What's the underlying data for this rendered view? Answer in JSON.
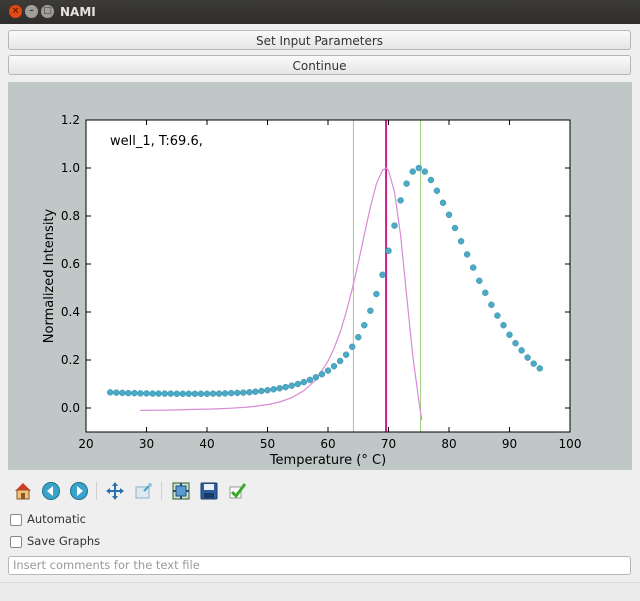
{
  "window": {
    "title": "NAMI"
  },
  "buttons": {
    "set_params_label": "Set Input Parameters",
    "continue_label": "Continue"
  },
  "plot": {
    "annotation": "well_1, T:69.6,"
  },
  "toolbar": {
    "icons": [
      "home-icon",
      "back-icon",
      "forward-icon",
      "pan-icon",
      "zoom-icon",
      "configure-subplots-icon",
      "save-icon",
      "check-icon"
    ]
  },
  "options": {
    "automatic_label": "Automatic",
    "automatic_checked": false,
    "save_graphs_label": "Save Graphs",
    "save_graphs_checked": false
  },
  "comment": {
    "placeholder": "Insert comments for the text file",
    "value": ""
  },
  "chart_data": {
    "type": "scatter",
    "title": "",
    "xlabel": "Temperature (° C)",
    "ylabel": "Normalized Intensity",
    "xlim": [
      20,
      100
    ],
    "ylim": [
      -0.1,
      1.2
    ],
    "xticks": [
      20,
      30,
      40,
      50,
      60,
      70,
      80,
      90,
      100
    ],
    "yticks": [
      0.0,
      0.2,
      0.4,
      0.6,
      0.8,
      1.0,
      1.2
    ],
    "xticklabels": [
      "20",
      "30",
      "40",
      "50",
      "60",
      "70",
      "80",
      "90",
      "100"
    ],
    "yticklabels": [
      "0.0",
      "0.2",
      "0.4",
      "0.6",
      "0.8",
      "1.0",
      "1.2"
    ],
    "series": [
      {
        "kind": "points",
        "color": "#4aabc7",
        "x": [
          24,
          25,
          26,
          27,
          28,
          29,
          30,
          31,
          32,
          33,
          34,
          35,
          36,
          37,
          38,
          39,
          40,
          41,
          42,
          43,
          44,
          45,
          46,
          47,
          48,
          49,
          50,
          51,
          52,
          53,
          54,
          55,
          56,
          57,
          58,
          59,
          60,
          61,
          62,
          63,
          64,
          65,
          66,
          67,
          68,
          69,
          70,
          71,
          72,
          73,
          74,
          75,
          76,
          77,
          78,
          79,
          80,
          81,
          82,
          83,
          84,
          85,
          86,
          87,
          88,
          89,
          90,
          91,
          92,
          93,
          94,
          95
        ],
        "y": [
          0.065,
          0.064,
          0.063,
          0.062,
          0.062,
          0.061,
          0.061,
          0.06,
          0.06,
          0.06,
          0.06,
          0.059,
          0.059,
          0.059,
          0.059,
          0.059,
          0.059,
          0.06,
          0.06,
          0.061,
          0.062,
          0.063,
          0.064,
          0.066,
          0.068,
          0.071,
          0.074,
          0.078,
          0.082,
          0.087,
          0.093,
          0.1,
          0.108,
          0.117,
          0.128,
          0.141,
          0.156,
          0.174,
          0.196,
          0.222,
          0.255,
          0.295,
          0.345,
          0.405,
          0.475,
          0.555,
          0.655,
          0.76,
          0.865,
          0.935,
          0.985,
          1.0,
          0.985,
          0.95,
          0.905,
          0.855,
          0.805,
          0.75,
          0.695,
          0.64,
          0.585,
          0.53,
          0.48,
          0.43,
          0.385,
          0.345,
          0.305,
          0.27,
          0.24,
          0.21,
          0.185,
          0.165
        ]
      },
      {
        "kind": "line",
        "color": "#d88ad6",
        "x": [
          29,
          32,
          35,
          38,
          41,
          44,
          47,
          50,
          52,
          54,
          56,
          58,
          60,
          61,
          62,
          63,
          64,
          65,
          66,
          67,
          68,
          69,
          69.6,
          70,
          71,
          72,
          73,
          74,
          75,
          75.5
        ],
        "y": [
          -0.01,
          -0.009,
          -0.008,
          -0.006,
          -0.004,
          -0.001,
          0.004,
          0.014,
          0.025,
          0.043,
          0.072,
          0.118,
          0.195,
          0.248,
          0.315,
          0.398,
          0.495,
          0.605,
          0.722,
          0.838,
          0.934,
          0.991,
          1.0,
          0.99,
          0.9,
          0.72,
          0.47,
          0.22,
          0.03,
          -0.05
        ]
      }
    ],
    "vlines": [
      {
        "x": 64.2,
        "color": "#9fce7b"
      },
      {
        "x": 69.6,
        "color": "#cc1f8a"
      },
      {
        "x": 75.3,
        "color": "#9fce7b"
      }
    ]
  }
}
